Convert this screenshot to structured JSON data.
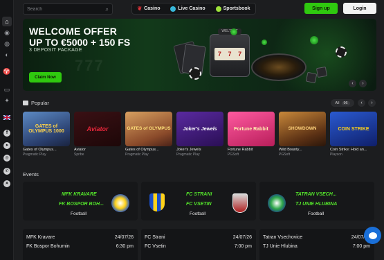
{
  "search": {
    "placeholder": "Search"
  },
  "nav": [
    {
      "label": "Casino",
      "color": "#e0343a"
    },
    {
      "label": "Live Casino",
      "color": "#38b6d8"
    },
    {
      "label": "Sportsbook",
      "color": "#9ee33a"
    }
  ],
  "auth": {
    "signup": "Sign up",
    "login": "Login"
  },
  "banner": {
    "line1": "WELCOME OFFER",
    "line2": "UP TO €5000 + 150 FS",
    "sub": "3 DEPOSIT PACKAGE",
    "cta": "Claim Now",
    "machine_brand": "WELTBET",
    "reels": [
      "7",
      "7",
      "7"
    ],
    "ghost": "777"
  },
  "popular": {
    "title": "Popular",
    "all_label": "All",
    "all_count": "96",
    "games": [
      {
        "name": "Gates of Olympus...",
        "provider": "Pragmatic Play",
        "art": "GATES of OLYMPUS 1000",
        "bg": "#3a5a8a"
      },
      {
        "name": "Aviator",
        "provider": "Spribe",
        "art": "Aviator",
        "bg": "#2a0d10"
      },
      {
        "name": "Gates of Olympus...",
        "provider": "Pragmatic Play",
        "art": "GATES of OLYMPUS",
        "bg": "#a06a3a"
      },
      {
        "name": "Joker's Jewels",
        "provider": "Pragmatic Play",
        "art": "Joker's Jewels",
        "bg": "#3a1a6a"
      },
      {
        "name": "Fortune Rabbit",
        "provider": "PGSoft",
        "art": "Fortune Rabbit",
        "bg": "#d03a7a"
      },
      {
        "name": "Wild Bounty...",
        "provider": "PGSoft",
        "art": "SHOWDOWN",
        "bg": "#5a3a1a"
      },
      {
        "name": "Coin Strike: Hold an...",
        "provider": "Playson",
        "art": "COIN STRIKE",
        "bg": "#1a3a8a"
      }
    ]
  },
  "events": {
    "title": "Events",
    "cards": [
      {
        "home": "MFK KRAVARE",
        "away": "FK BOSPOR BOH...",
        "sport": "Football"
      },
      {
        "home": "FC STRANI",
        "away": "FC VSETIN",
        "sport": "Football"
      },
      {
        "home": "TATRAN VSECH...",
        "away": "TJ UNIE HLUBINA",
        "sport": "Football"
      }
    ],
    "matches": [
      {
        "home": "MFK Kravare",
        "away": "FK Bospor Bohumin",
        "date": "24/07/26",
        "time": "6:30 pm"
      },
      {
        "home": "FC Strani",
        "away": "FC Vsetin",
        "date": "24/07/26",
        "time": "7:00 pm"
      },
      {
        "home": "Tatran Vsechovice",
        "away": "TJ Unie Hlubina",
        "date": "24/07/26",
        "time": "7:00 pm"
      }
    ]
  },
  "sidebar_icons": [
    "home-icon",
    "casino-chip-icon",
    "sports-ball-icon",
    "live-icon",
    "trophy-icon",
    "ticket-icon",
    "promotions-icon",
    "language-flag-icon",
    "facebook-icon",
    "telegram-icon",
    "instagram-icon",
    "whatsapp-icon",
    "x-icon"
  ],
  "chat": {
    "icon": "chat-bubble-icon"
  }
}
